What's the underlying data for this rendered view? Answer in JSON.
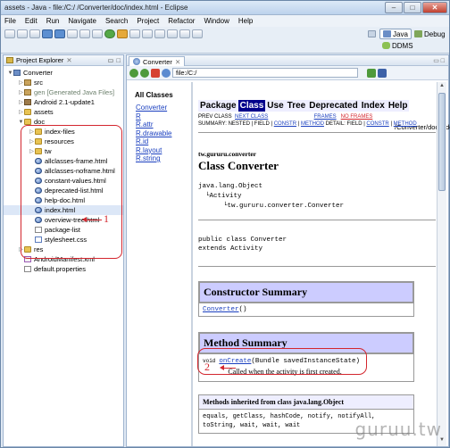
{
  "window": {
    "title": "assets - Java - file:/C:/                          /Converter/doc/index.html - Eclipse",
    "buttons": [
      "–",
      "□",
      "✕"
    ]
  },
  "menu": [
    "File",
    "Edit",
    "Run",
    "Navigate",
    "Search",
    "Project",
    "Refactor",
    "Window",
    "Help"
  ],
  "perspectives": [
    {
      "label": "Java",
      "active": true,
      "icon": "java-perspective-icon"
    },
    {
      "label": "Debug",
      "active": false,
      "icon": "debug-perspective-icon"
    },
    {
      "label": "DDMS",
      "active": false,
      "icon": "android-ddms-icon"
    }
  ],
  "explorer": {
    "title": "Project Explorer",
    "tree": [
      {
        "label": "Converter",
        "depth": 0,
        "icon": "project",
        "open": true
      },
      {
        "label": "src",
        "depth": 1,
        "icon": "pkg"
      },
      {
        "label": "gen [Generated Java Files]",
        "depth": 1,
        "icon": "pkg",
        "greyed": true
      },
      {
        "label": "Android 2.1-update1",
        "depth": 1,
        "icon": "jar"
      },
      {
        "label": "assets",
        "depth": 1,
        "icon": "folder"
      },
      {
        "label": "doc",
        "depth": 1,
        "icon": "folder",
        "open": true
      },
      {
        "label": "index-files",
        "depth": 2,
        "icon": "folder"
      },
      {
        "label": "resources",
        "depth": 2,
        "icon": "folder"
      },
      {
        "label": "tw",
        "depth": 2,
        "icon": "folder"
      },
      {
        "label": "allclasses-frame.html",
        "depth": 2,
        "icon": "html"
      },
      {
        "label": "allclasses-noframe.html",
        "depth": 2,
        "icon": "html"
      },
      {
        "label": "constant-values.html",
        "depth": 2,
        "icon": "html"
      },
      {
        "label": "deprecated-list.html",
        "depth": 2,
        "icon": "html"
      },
      {
        "label": "help-doc.html",
        "depth": 2,
        "icon": "html"
      },
      {
        "label": "index.html",
        "depth": 2,
        "icon": "html",
        "selected": true
      },
      {
        "label": "overview-tree.html",
        "depth": 2,
        "icon": "html"
      },
      {
        "label": "package-list",
        "depth": 2,
        "icon": "file"
      },
      {
        "label": "stylesheet.css",
        "depth": 2,
        "icon": "css"
      },
      {
        "label": "res",
        "depth": 1,
        "icon": "folder"
      },
      {
        "label": "AndroidManifest.xml",
        "depth": 1,
        "icon": "xml"
      },
      {
        "label": "default.properties",
        "depth": 1,
        "icon": "file"
      }
    ]
  },
  "callouts": {
    "one": "1",
    "two": "2"
  },
  "editor": {
    "tab": "Converter",
    "url_left": "file:/C:/",
    "url_right": "/Converter/doc/index.html"
  },
  "all_classes": {
    "header": "All Classes",
    "items": [
      "Converter",
      "R",
      "R.attr",
      "R.drawable",
      "R.id",
      "R.layout",
      "R.string"
    ]
  },
  "javadoc": {
    "navbar": [
      "Package",
      "Class",
      "Use",
      "Tree",
      "Deprecated",
      "Index",
      "Help"
    ],
    "navbar_current": "Class",
    "subnav_line1": {
      "prev": "PREV CLASS",
      "next": "NEXT CLASS",
      "frames": "FRAMES",
      "noframes": "NO FRAMES"
    },
    "subnav_line2": {
      "summary": "SUMMARY: NESTED | FIELD |",
      "constr": "CONSTR",
      "sep": "|",
      "method": "METHOD",
      "detail": "DETAIL: FIELD |",
      "constr2": "CONSTR",
      "method2": "METHOD"
    },
    "package": "tw.gururu.converter",
    "class_title": "Class Converter",
    "hierarchy": [
      "java.lang.Object",
      "Activity",
      "tw.gururu.converter.Converter"
    ],
    "decl_line1": "public class Converter",
    "decl_line2": "extends Activity",
    "constructor_summary": "Constructor Summary",
    "constructor_name": "Converter",
    "constructor_parens": "()",
    "method_summary": "Method Summary",
    "method_type": "void",
    "method_name": "onCreate",
    "method_sig": "(Bundle savedInstanceState)",
    "method_desc": "Called when the activity is first created.",
    "inherited_head": "Methods inherited from class java.lang.Object",
    "inherited_list": "equals, getClass, hashCode, notify, notifyAll, toString, wait, wait, wait"
  },
  "watermark": "guruu.tw"
}
